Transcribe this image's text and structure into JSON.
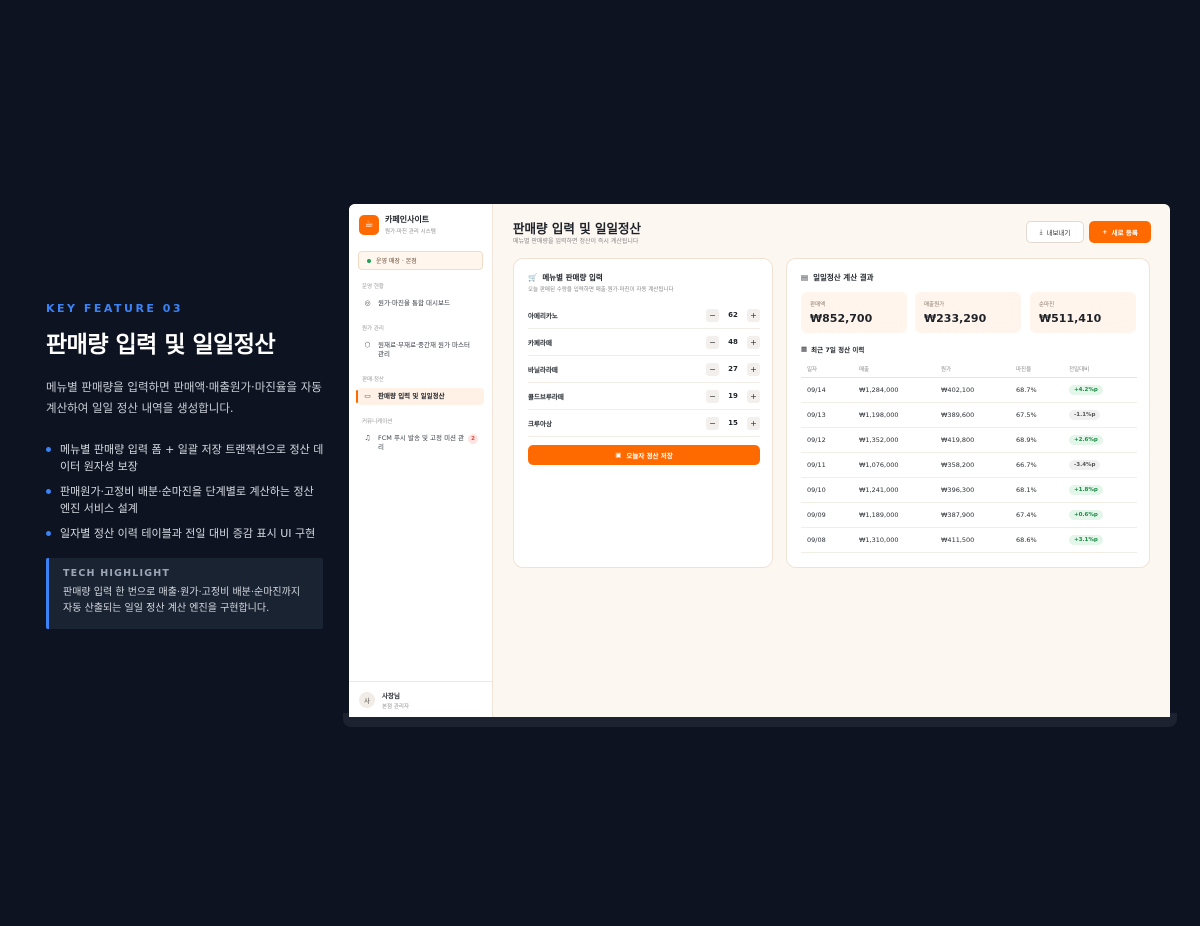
{
  "promo": {
    "kicker": "KEY FEATURE 03",
    "title": "판매량 입력 및 일일정산",
    "description": "메뉴별 판매량을 입력하면 판매액·매출원가·마진율을 자동 계산하여 일일 정산 내역을 생성합니다.",
    "bullets": [
      "메뉴별 판매량 입력 폼 + 일괄 저장 트랜잭션으로 정산 데이터 원자성 보장",
      "판매원가·고정비 배분·순마진을 단계별로 계산하는 정산 엔진 서비스 설계",
      "일자별 정산 이력 테이블과 전일 대비 증감 표시 UI 구현"
    ],
    "highlight_title": "TECH HIGHLIGHT",
    "highlight_text": "판매량 입력 한 번으로 매출·원가·고정비 배분·순마진까지 자동 산출되는 일일 정산 계산 엔진을 구현합니다."
  },
  "sidebar": {
    "brand_name": "카페인사이트",
    "brand_sub": "원가·마진 관리 시스템",
    "store": "운영 매장 · 본점",
    "sections": [
      {
        "label": "운영 현황",
        "items": [
          {
            "label": "원가·마진율 통합 대시보드",
            "icon": "chart-icon",
            "glyph": "◎"
          }
        ]
      },
      {
        "label": "원가 관리",
        "items": [
          {
            "label": "원재료·부재료·중간재 원가 마스터 관리",
            "icon": "box-icon",
            "glyph": "⬡"
          }
        ]
      },
      {
        "label": "판매·정산",
        "items": [
          {
            "label": "판매량 입력 및 일일정산",
            "icon": "receipt-icon",
            "glyph": "▭"
          }
        ]
      },
      {
        "label": "커뮤니케이션",
        "items": [
          {
            "label": "FCM 푸시 발송 및 고정 미션 관리",
            "icon": "bell-icon",
            "glyph": "♫",
            "badge": "2"
          }
        ]
      }
    ],
    "user_initial": "사",
    "user_name": "사장님",
    "user_role": "본점 관리자"
  },
  "header": {
    "title": "판매량 입력 및 일일정산",
    "subtitle": "메뉴별 판매량을 입력하면 정산이 즉시 계산됩니다",
    "export_label": "내보내기",
    "new_label": "새로 등록"
  },
  "sales_input": {
    "title": "메뉴별 판매량 입력",
    "subtitle": "오늘 판매된 수량을 입력하면 매출·원가·마진이 자동 계산됩니다",
    "items": [
      {
        "name": "아메리카노",
        "qty": "62"
      },
      {
        "name": "카페라떼",
        "qty": "48"
      },
      {
        "name": "바닐라라떼",
        "qty": "27"
      },
      {
        "name": "콜드브루라떼",
        "qty": "19"
      },
      {
        "name": "크루아상",
        "qty": "15"
      }
    ],
    "minus": "−",
    "plus": "+",
    "save_label": "오늘자 정산 저장"
  },
  "settlement": {
    "title": "일일정산 계산 결과",
    "stats": [
      {
        "label": "판매액",
        "value": "₩852,700"
      },
      {
        "label": "매출원가",
        "value": "₩233,290"
      },
      {
        "label": "순마진",
        "value": "₩511,410"
      }
    ],
    "history_title": "최근 7일 정산 이력",
    "columns": [
      "일자",
      "매출",
      "원가",
      "마진율",
      "전일대비"
    ],
    "rows": [
      {
        "date": "09/14",
        "sales": "₩1,284,000",
        "cost": "₩402,100",
        "margin": "68.7%",
        "change": "+4.2%p",
        "dir": "up"
      },
      {
        "date": "09/13",
        "sales": "₩1,198,000",
        "cost": "₩389,600",
        "margin": "67.5%",
        "change": "-1.1%p",
        "dir": "down"
      },
      {
        "date": "09/12",
        "sales": "₩1,352,000",
        "cost": "₩419,800",
        "margin": "68.9%",
        "change": "+2.6%p",
        "dir": "up"
      },
      {
        "date": "09/11",
        "sales": "₩1,076,000",
        "cost": "₩358,200",
        "margin": "66.7%",
        "change": "-3.4%p",
        "dir": "down"
      },
      {
        "date": "09/10",
        "sales": "₩1,241,000",
        "cost": "₩396,300",
        "margin": "68.1%",
        "change": "+1.8%p",
        "dir": "up"
      },
      {
        "date": "09/09",
        "sales": "₩1,189,000",
        "cost": "₩387,900",
        "margin": "67.4%",
        "change": "+0.6%p",
        "dir": "up"
      },
      {
        "date": "09/08",
        "sales": "₩1,310,000",
        "cost": "₩411,500",
        "margin": "68.6%",
        "change": "+3.1%p",
        "dir": "up"
      }
    ]
  },
  "colors": {
    "accent": "#ff6a00",
    "promo_accent": "#3b82f6",
    "up": "#1c8a45"
  }
}
